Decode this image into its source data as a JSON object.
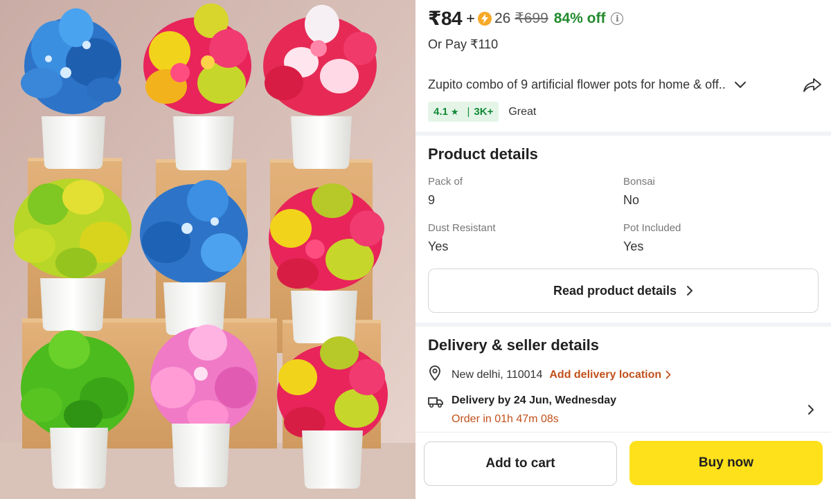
{
  "colors": {
    "price_discount": "#238a2e",
    "rating_badge_bg": "#e4f5e8",
    "rating_badge_text": "#138a36",
    "accent_orange": "#c1511b",
    "buy_now_bg": "#ffe11b",
    "coin": "#f7a928"
  },
  "product_image": {
    "description_icon": "product-photo"
  },
  "price": {
    "selling": "₹84",
    "plus": "+",
    "coin_icon": "supercoin-lightning-icon",
    "coins": "26",
    "mrp": "₹699",
    "discount": "84% off",
    "info_icon": "info-icon"
  },
  "or_pay": "Or Pay ₹110",
  "product": {
    "title": "Zupito combo of 9 artificial flower pots for home & off..",
    "expand_icon": "chevron-down-icon",
    "share_icon": "share-icon"
  },
  "rating": {
    "value": "4.1",
    "star": "★",
    "separator": "|",
    "count": "3K+",
    "label": "Great"
  },
  "product_details": {
    "title": "Product details",
    "specs": [
      {
        "label": "Pack of",
        "value": "9"
      },
      {
        "label": "Bonsai",
        "value": "No"
      },
      {
        "label": "Dust Resistant",
        "value": "Yes"
      },
      {
        "label": "Pot Included",
        "value": "Yes"
      }
    ],
    "read_more": "Read product details"
  },
  "delivery": {
    "title": "Delivery & seller details",
    "location": "New delhi, 110014",
    "add_location": "Add delivery location",
    "delivery_by": "Delivery by 24 Jun, Wednesday",
    "order_in": "Order in 01h 47m 08s"
  },
  "actions": {
    "add_to_cart": "Add to cart",
    "buy_now": "Buy now"
  }
}
